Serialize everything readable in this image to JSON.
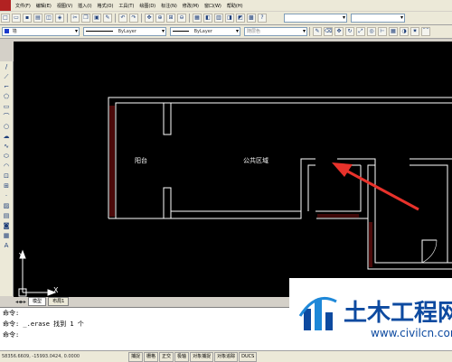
{
  "menu": [
    "文件(F)",
    "编辑(E)",
    "视图(V)",
    "插入(I)",
    "格式(O)",
    "工具(T)",
    "绘图(D)",
    "标注(N)",
    "修改(M)",
    "窗口(W)",
    "帮助(H)"
  ],
  "properties": {
    "layer": "墙",
    "linetype1": "ByLayer",
    "linetype2": "ByLayer",
    "color": "随层色"
  },
  "drawing": {
    "label_left": "阳台",
    "label_center": "公共区域"
  },
  "axis": {
    "x": "X",
    "y": "Y"
  },
  "tabs": {
    "model": "模型",
    "layout": "布局1"
  },
  "command": {
    "line1": "命令:",
    "line2": "命令: _.erase 找到 1 个",
    "line3": "命令:"
  },
  "status": {
    "coords": "58356.6609, -15993.0424, 0.0000",
    "buttons": [
      "捕捉",
      "栅格",
      "正交",
      "极轴",
      "对象捕捉",
      "对象追踪",
      "DUCS"
    ]
  },
  "watermark": {
    "title": "土木工程网",
    "url": "www.civilcn.com"
  },
  "colors": {
    "canvas": "#000000",
    "lines": "#ffffff",
    "red_lines": "#ff2020",
    "arrow": "#e8322b",
    "brand": "#0d4aa0"
  }
}
